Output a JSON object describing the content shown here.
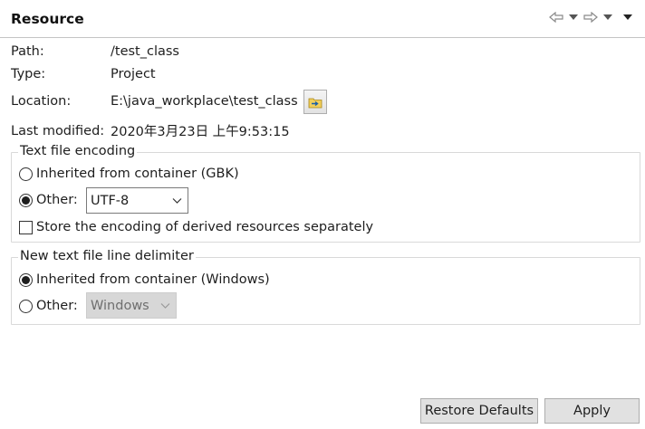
{
  "header": {
    "title": "Resource"
  },
  "nav": {
    "back_icon": "back-arrow-icon",
    "forward_icon": "forward-arrow-icon",
    "menu_icon": "view-menu-icon"
  },
  "info": {
    "path_label": "Path:",
    "path_value": "/test_class",
    "type_label": "Type:",
    "type_value": "Project",
    "location_label": "Location:",
    "location_value": "E:\\java_workplace\\test_class",
    "modified_label": "Last modified:",
    "modified_value": "2020年3月23日 上午9:53:15"
  },
  "encoding": {
    "title": "Text file encoding",
    "inherited_label": "Inherited from container (GBK)",
    "inherited_selected": false,
    "other_label": "Other:",
    "other_selected": true,
    "other_value": "UTF-8",
    "store_label": "Store the encoding of derived resources separately",
    "store_checked": false
  },
  "delimiter": {
    "title": "New text file line delimiter",
    "inherited_label": "Inherited from container (Windows)",
    "inherited_selected": true,
    "other_label": "Other:",
    "other_selected": false,
    "other_value": "Windows"
  },
  "footer": {
    "restore_label": "Restore Defaults",
    "apply_label": "Apply"
  },
  "colors": {
    "group_border": "#d9d9d9",
    "button_bg": "#e1e1e1",
    "disabled_bg": "#d7d7d7"
  }
}
